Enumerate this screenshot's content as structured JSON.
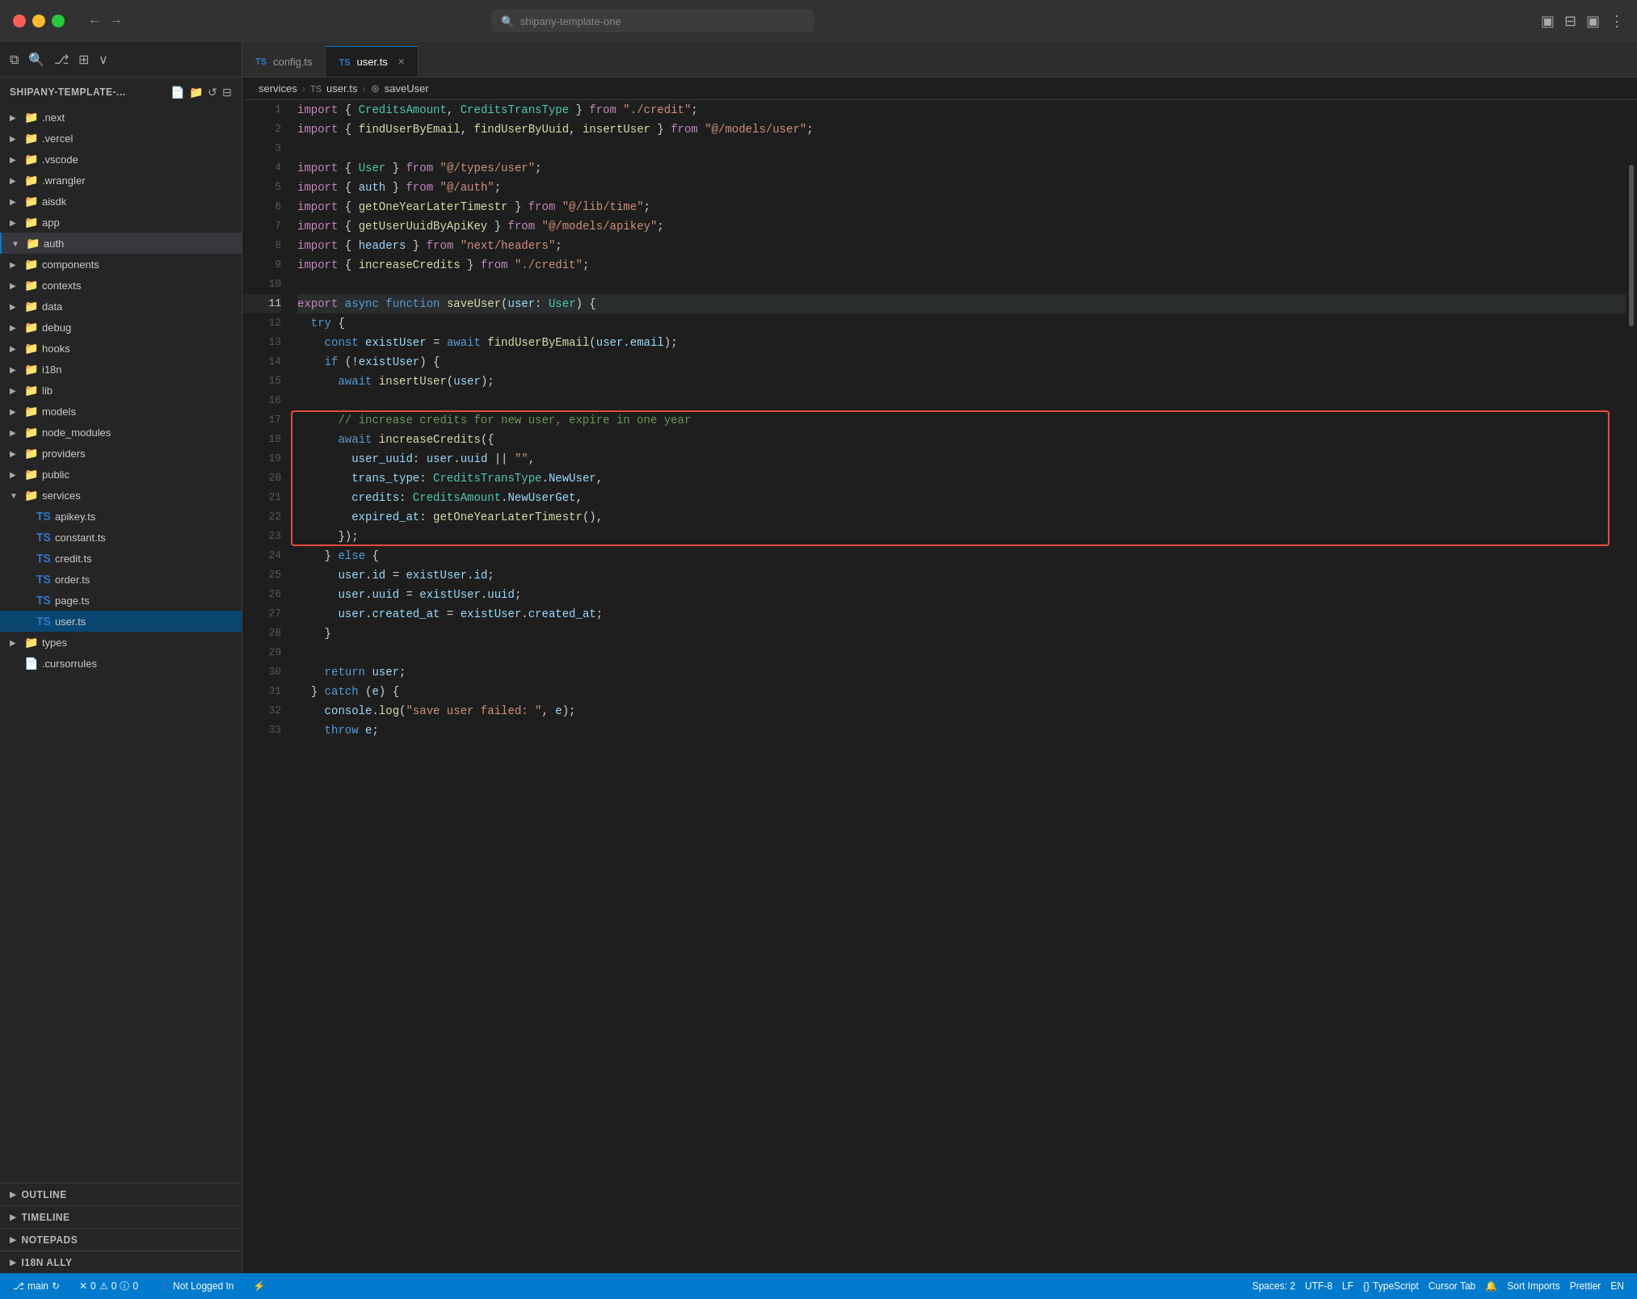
{
  "titlebar": {
    "search_placeholder": "shipany-template-one",
    "nav_back": "←",
    "nav_forward": "→"
  },
  "explorer": {
    "title": "SHIPANY-TEMPLATE-...",
    "actions": [
      "new-file",
      "new-folder",
      "refresh",
      "collapse"
    ],
    "tree": [
      {
        "id": "next",
        "label": ".next",
        "type": "folder",
        "icon": "📁",
        "depth": 1,
        "collapsed": true
      },
      {
        "id": "vercel",
        "label": ".vercel",
        "type": "folder",
        "icon": "📁",
        "depth": 1,
        "collapsed": true
      },
      {
        "id": "vscode",
        "label": ".vscode",
        "type": "folder",
        "icon": "📁",
        "depth": 1,
        "collapsed": true
      },
      {
        "id": "wrangler",
        "label": ".wrangler",
        "type": "folder",
        "icon": "📁",
        "depth": 1,
        "collapsed": true
      },
      {
        "id": "aisdk",
        "label": "aisdk",
        "type": "folder",
        "icon": "📁",
        "depth": 1,
        "collapsed": true
      },
      {
        "id": "app",
        "label": "app",
        "type": "folder",
        "icon": "📁",
        "depth": 1,
        "collapsed": true
      },
      {
        "id": "auth",
        "label": "auth",
        "type": "folder",
        "icon": "📁",
        "depth": 1,
        "active": true,
        "collapsed": false
      },
      {
        "id": "components",
        "label": "components",
        "type": "folder",
        "icon": "📁",
        "depth": 1,
        "collapsed": true
      },
      {
        "id": "contexts",
        "label": "contexts",
        "type": "folder",
        "icon": "📁",
        "depth": 1,
        "collapsed": true
      },
      {
        "id": "data",
        "label": "data",
        "type": "folder",
        "icon": "📁",
        "depth": 1,
        "collapsed": true
      },
      {
        "id": "debug",
        "label": "debug",
        "type": "folder",
        "icon": "📁",
        "depth": 1,
        "collapsed": true
      },
      {
        "id": "hooks",
        "label": "hooks",
        "type": "folder",
        "icon": "📁",
        "depth": 1,
        "collapsed": true
      },
      {
        "id": "i18n",
        "label": "i18n",
        "type": "folder",
        "icon": "📁",
        "depth": 1,
        "collapsed": true
      },
      {
        "id": "lib",
        "label": "lib",
        "type": "folder",
        "icon": "📁",
        "depth": 1,
        "collapsed": true
      },
      {
        "id": "models",
        "label": "models",
        "type": "folder",
        "icon": "📁",
        "depth": 1,
        "collapsed": true
      },
      {
        "id": "node_modules",
        "label": "node_modules",
        "type": "folder",
        "icon": "📁",
        "depth": 1,
        "collapsed": true
      },
      {
        "id": "providers",
        "label": "providers",
        "type": "folder",
        "icon": "📁",
        "depth": 1,
        "collapsed": true
      },
      {
        "id": "public",
        "label": "public",
        "type": "folder",
        "icon": "📁",
        "depth": 1,
        "collapsed": true
      },
      {
        "id": "services",
        "label": "services",
        "type": "folder",
        "icon": "📁",
        "depth": 1,
        "collapsed": false
      },
      {
        "id": "apikey.ts",
        "label": "apikey.ts",
        "type": "ts-file",
        "depth": 2
      },
      {
        "id": "constant.ts",
        "label": "constant.ts",
        "type": "ts-file",
        "depth": 2
      },
      {
        "id": "credit.ts",
        "label": "credit.ts",
        "type": "ts-file",
        "depth": 2
      },
      {
        "id": "order.ts",
        "label": "order.ts",
        "type": "ts-file",
        "depth": 2
      },
      {
        "id": "page.ts",
        "label": "page.ts",
        "type": "ts-file",
        "depth": 2
      },
      {
        "id": "user.ts",
        "label": "user.ts",
        "type": "ts-file",
        "depth": 2,
        "selected": true
      },
      {
        "id": "types",
        "label": "types",
        "type": "folder",
        "icon": "📁",
        "depth": 1,
        "collapsed": true
      },
      {
        "id": ".cursorrules",
        "label": ".cursorrules",
        "type": "file",
        "depth": 1
      }
    ],
    "panels": [
      {
        "id": "outline",
        "label": "OUTLINE"
      },
      {
        "id": "timeline",
        "label": "TIMELINE"
      },
      {
        "id": "notepads",
        "label": "NOTEPADS"
      },
      {
        "id": "i18n-ally",
        "label": "I18N ALLY"
      }
    ]
  },
  "tabs": [
    {
      "id": "config.ts",
      "label": "config.ts",
      "active": false,
      "closable": false,
      "ts": true
    },
    {
      "id": "user.ts",
      "label": "user.ts",
      "active": true,
      "closable": true,
      "ts": true
    }
  ],
  "breadcrumb": {
    "parts": [
      "services",
      "user.ts",
      "saveUser"
    ]
  },
  "code": {
    "filename": "user.ts",
    "lines": [
      {
        "num": 1,
        "content": "import { CreditsAmount, CreditsTransType } from \"./credit\";"
      },
      {
        "num": 2,
        "content": "import { findUserByEmail, findUserByUuid, insertUser } from \"@/models/user\";"
      },
      {
        "num": 3,
        "content": ""
      },
      {
        "num": 4,
        "content": "import { User } from \"@/types/user\";"
      },
      {
        "num": 5,
        "content": "import { auth } from \"@/auth\";"
      },
      {
        "num": 6,
        "content": "import { getOneYearLaterTimestr } from \"@/lib/time\";"
      },
      {
        "num": 7,
        "content": "import { getUserUuidByApiKey } from \"@/models/apikey\";"
      },
      {
        "num": 8,
        "content": "import { headers } from \"next/headers\";"
      },
      {
        "num": 9,
        "content": "import { increaseCredits } from \"./credit\";"
      },
      {
        "num": 10,
        "content": ""
      },
      {
        "num": 11,
        "content": "export async function saveUser(user: User) {",
        "active": true
      },
      {
        "num": 12,
        "content": "  try {"
      },
      {
        "num": 13,
        "content": "    const existUser = await findUserByEmail(user.email);"
      },
      {
        "num": 14,
        "content": "    if (!existUser) {"
      },
      {
        "num": 15,
        "content": "      await insertUser(user);"
      },
      {
        "num": 16,
        "content": ""
      },
      {
        "num": 17,
        "content": "      // increase credits for new user, expire in one year",
        "box_start": true
      },
      {
        "num": 18,
        "content": "      await increaseCredits({"
      },
      {
        "num": 19,
        "content": "        user_uuid: user.uuid || \"\","
      },
      {
        "num": 20,
        "content": "        trans_type: CreditsTransType.NewUser,"
      },
      {
        "num": 21,
        "content": "        credits: CreditsAmount.NewUserGet,"
      },
      {
        "num": 22,
        "content": "        expired_at: getOneYearLaterTimestr(),"
      },
      {
        "num": 23,
        "content": "      });",
        "box_end": true
      },
      {
        "num": 24,
        "content": "    } else {"
      },
      {
        "num": 25,
        "content": "      user.id = existUser.id;"
      },
      {
        "num": 26,
        "content": "      user.uuid = existUser.uuid;"
      },
      {
        "num": 27,
        "content": "      user.created_at = existUser.created_at;"
      },
      {
        "num": 28,
        "content": "    }"
      },
      {
        "num": 29,
        "content": ""
      },
      {
        "num": 30,
        "content": "    return user;"
      },
      {
        "num": 31,
        "content": "  } catch (e) {"
      },
      {
        "num": 32,
        "content": "    console.log(\"save user failed: \", e);"
      },
      {
        "num": 33,
        "content": "    throw e;"
      }
    ]
  },
  "statusbar": {
    "branch": "main",
    "errors": "0",
    "warnings": "0",
    "info": "0",
    "spaces": "Spaces: 2",
    "encoding": "UTF-8",
    "line_ending": "LF",
    "language": "TypeScript",
    "cursor": "Cursor Tab",
    "sort_imports": "Sort Imports",
    "prettier": "Prettier",
    "locale": "EN"
  }
}
